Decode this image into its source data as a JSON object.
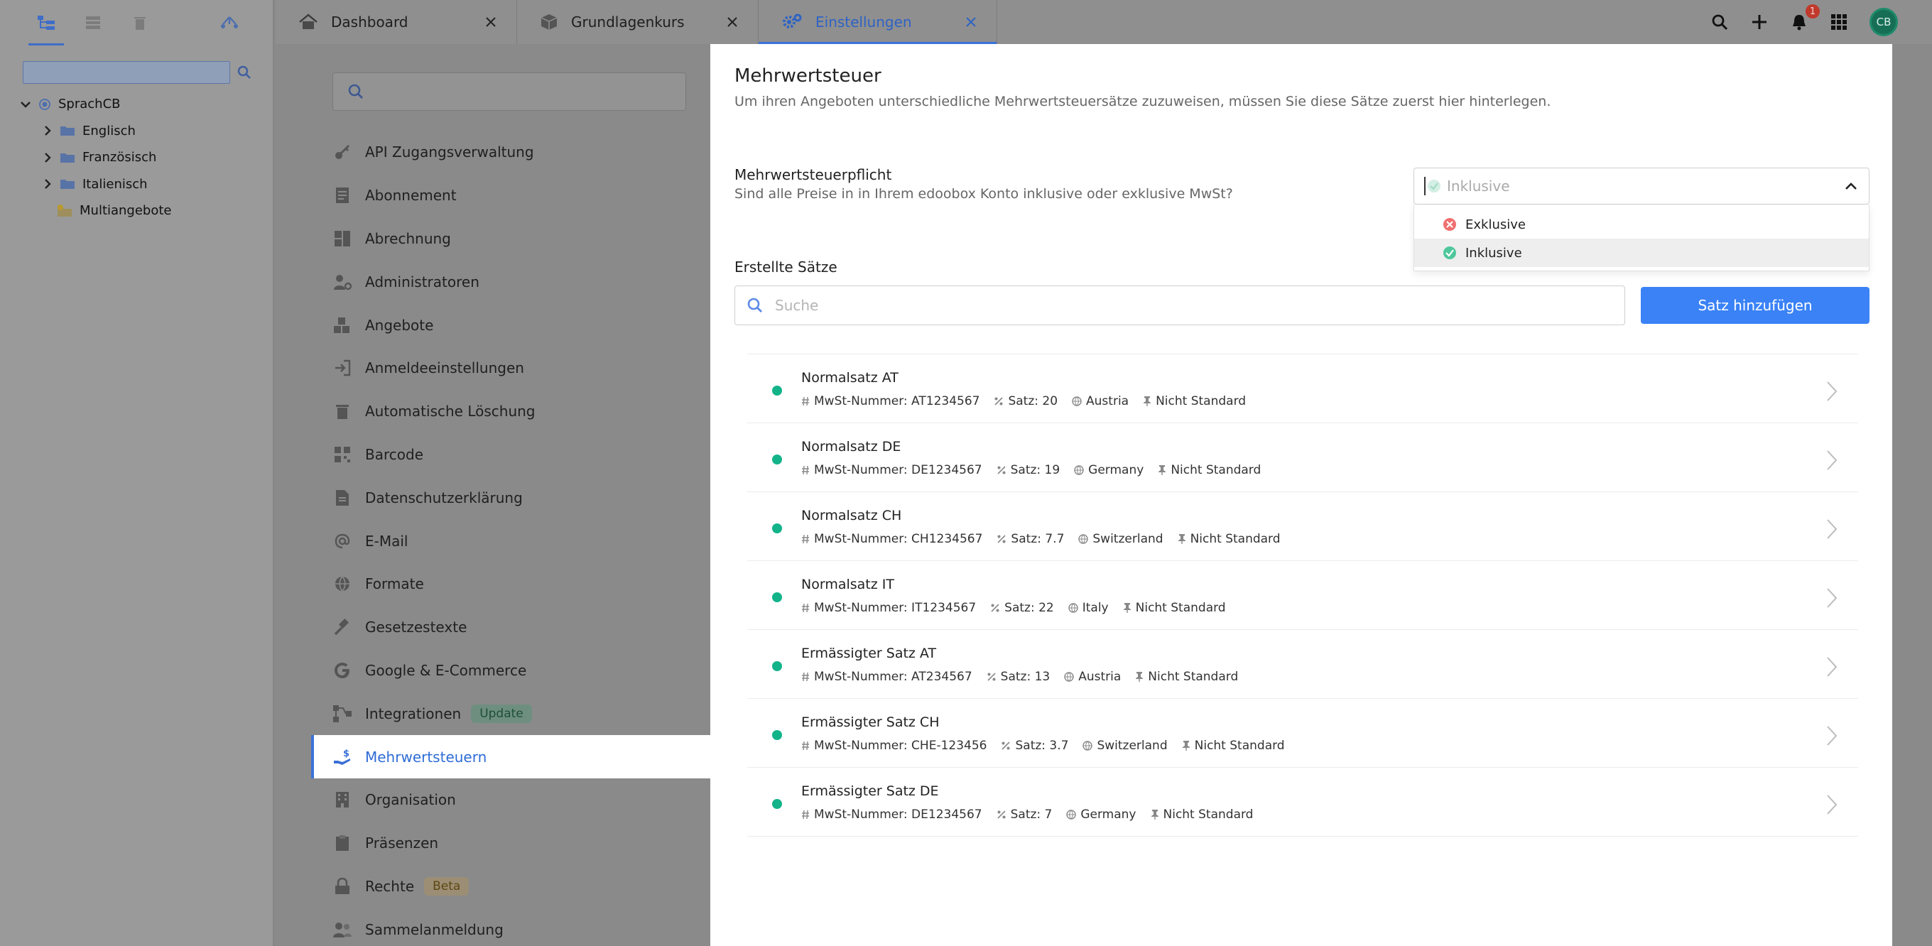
{
  "tree": {
    "tools": [
      "tree-view-icon",
      "list-icon",
      "trash-icon",
      "hierarchy-icon"
    ],
    "nodes": [
      {
        "label": "SprachCB",
        "level": 0,
        "type": "root"
      },
      {
        "label": "Englisch",
        "level": 1,
        "type": "folder"
      },
      {
        "label": "Französisch",
        "level": 1,
        "type": "folder"
      },
      {
        "label": "Italienisch",
        "level": 1,
        "type": "folder"
      },
      {
        "label": "Multiangebote",
        "level": 2,
        "type": "special"
      }
    ]
  },
  "tabs": [
    {
      "label": "Dashboard",
      "icon": "home-icon",
      "active": false
    },
    {
      "label": "Grundlagenkurs",
      "icon": "box-icon",
      "active": false
    },
    {
      "label": "Einstellungen",
      "icon": "gear-icon",
      "active": true
    }
  ],
  "topbar": {
    "notification_count": "1",
    "avatar_initials": "CB"
  },
  "nav": {
    "items": [
      {
        "label": "API Zugangsverwaltung",
        "icon": "key-icon"
      },
      {
        "label": "Abonnement",
        "icon": "receipt-icon"
      },
      {
        "label": "Abrechnung",
        "icon": "invoice-icon"
      },
      {
        "label": "Administratoren",
        "icon": "user-gear-icon"
      },
      {
        "label": "Angebote",
        "icon": "cubes-icon"
      },
      {
        "label": "Anmeldeeinstellungen",
        "icon": "login-icon"
      },
      {
        "label": "Automatische Löschung",
        "icon": "trash-icon"
      },
      {
        "label": "Barcode",
        "icon": "qrcode-icon"
      },
      {
        "label": "Datenschutzerklärung",
        "icon": "document-icon"
      },
      {
        "label": "E-Mail",
        "icon": "at-icon"
      },
      {
        "label": "Formate",
        "icon": "globe-icon"
      },
      {
        "label": "Gesetzestexte",
        "icon": "gavel-icon"
      },
      {
        "label": "Google & E-Commerce",
        "icon": "google-icon"
      },
      {
        "label": "Integrationen",
        "icon": "network-icon",
        "badge": "Update"
      },
      {
        "label": "Mehrwertsteuern",
        "icon": "hand-dollar-icon",
        "active": true
      },
      {
        "label": "Organisation",
        "icon": "building-icon"
      },
      {
        "label": "Präsenzen",
        "icon": "clipboard-icon"
      },
      {
        "label": "Rechte",
        "icon": "lock-icon",
        "badge": "Beta"
      },
      {
        "label": "Sammelanmeldung",
        "icon": "users-icon"
      }
    ]
  },
  "main": {
    "title": "Mehrwertsteuer",
    "subtitle": "Um ihren Angeboten unterschiedliche Mehrwertsteuersätze zuzuweisen, müssen Sie diese Sätze zuerst hier hinterlegen.",
    "pflicht": {
      "label": "Mehrwertsteuerpflicht",
      "question": "Sind alle Preise in in Ihrem edoobox Konto inklusive oder exklusive MwSt?",
      "selected": "Inklusive",
      "options": [
        {
          "label": "Exklusive",
          "icon": "x-circle-icon"
        },
        {
          "label": "Inklusive",
          "icon": "check-circle-icon"
        }
      ]
    },
    "rates_title": "Erstellte Sätze",
    "search_placeholder": "Suche",
    "add_button": "Satz hinzufügen",
    "rates": [
      {
        "name": "Normalsatz AT",
        "vat_number": "MwSt-Nummer: AT1234567",
        "rate": "Satz: 20",
        "country": "Austria",
        "standard": "Nicht Standard"
      },
      {
        "name": "Normalsatz DE",
        "vat_number": "MwSt-Nummer: DE1234567",
        "rate": "Satz: 19",
        "country": "Germany",
        "standard": "Nicht Standard"
      },
      {
        "name": "Normalsatz CH",
        "vat_number": "MwSt-Nummer: CH1234567",
        "rate": "Satz: 7.7",
        "country": "Switzerland",
        "standard": "Nicht Standard"
      },
      {
        "name": "Normalsatz IT",
        "vat_number": "MwSt-Nummer: IT1234567",
        "rate": "Satz: 22",
        "country": "Italy",
        "standard": "Nicht Standard"
      },
      {
        "name": "Ermässigter Satz AT",
        "vat_number": "MwSt-Nummer: AT234567",
        "rate": "Satz: 13",
        "country": "Austria",
        "standard": "Nicht Standard"
      },
      {
        "name": "Ermässigter Satz CH",
        "vat_number": "MwSt-Nummer: CHE-123456",
        "rate": "Satz: 3.7",
        "country": "Switzerland",
        "standard": "Nicht Standard"
      },
      {
        "name": "Ermässigter Satz DE",
        "vat_number": "MwSt-Nummer: DE1234567",
        "rate": "Satz: 7",
        "country": "Germany",
        "standard": "Nicht Standard"
      }
    ]
  },
  "colors": {
    "accent": "#3a82f6",
    "active_dot": "#13b38a",
    "nav_active": "#2f6cd6"
  }
}
